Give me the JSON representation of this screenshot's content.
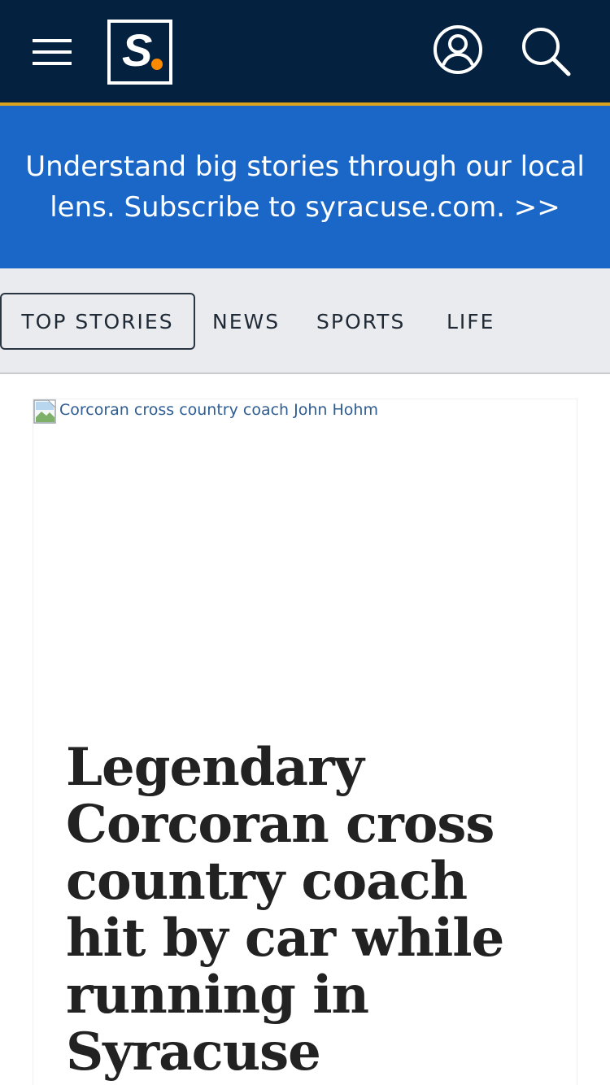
{
  "header": {
    "menu_icon": "hamburger-menu-icon",
    "logo_letter": "S",
    "logo_dot_color": "#ff8a00",
    "user_icon": "user-account-icon",
    "search_icon": "search-icon",
    "background_color": "#04213f",
    "accent_color": "#d9a320"
  },
  "promo": {
    "text": "Understand big stories through our local lens. Subscribe to syracuse.com. >>",
    "background_color": "#1a67c8"
  },
  "tabs": [
    {
      "label": "TOP STORIES",
      "active": true
    },
    {
      "label": "NEWS",
      "active": false
    },
    {
      "label": "SPORTS",
      "active": false
    },
    {
      "label": "LIFE",
      "active": false
    }
  ],
  "article": {
    "image_alt": "Corcoran cross country coach John Hohm",
    "image_icon": "broken-image-icon",
    "headline": "Legendary Corcoran cross country coach hit by car while running in Syracuse"
  }
}
